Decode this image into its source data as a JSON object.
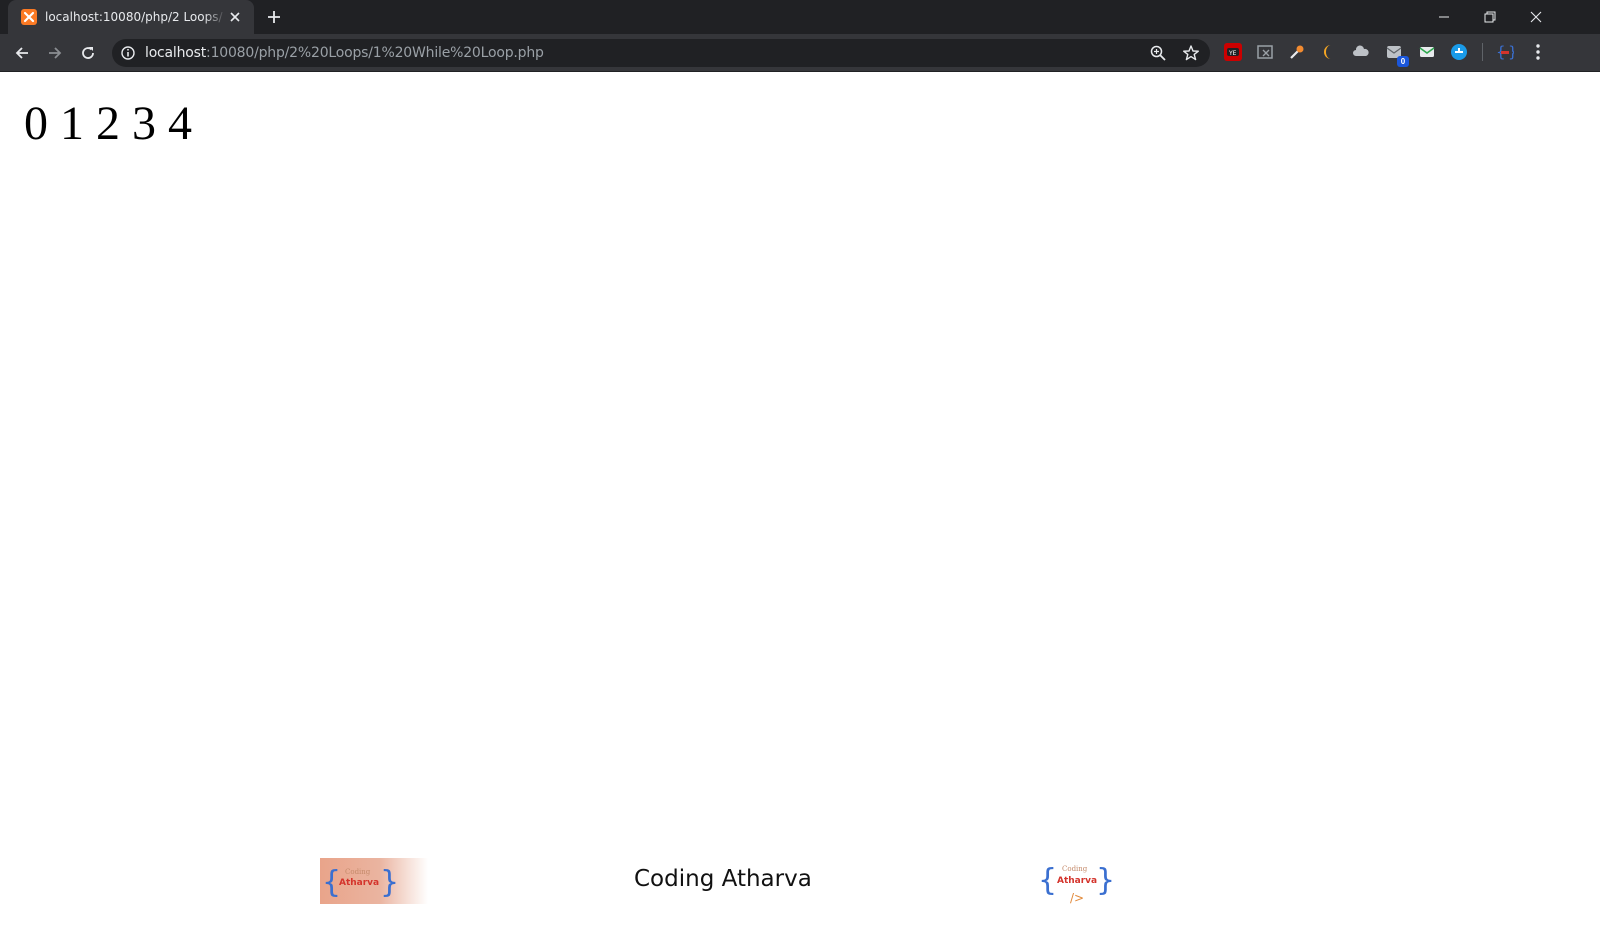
{
  "browser": {
    "tab": {
      "title": "localhost:10080/php/2 Loops/1 While Loop.php",
      "favicon": "xampp-icon"
    },
    "url": {
      "host": "localhost",
      "path": ":10080/php/2%20Loops/1%20While%20Loop.php"
    },
    "extensions": [
      "youtube-icon",
      "screen-capture-icon",
      "colorpick-icon",
      "moon-icon",
      "cloud-icon",
      "mail-checker-icon",
      "email-icon",
      "grammar-icon",
      "coding-atharva-ext-icon"
    ],
    "extension_badge": "0",
    "colors": {
      "tabbar": "#202124",
      "toolbar": "#35363a",
      "favicon": "#fb7a24"
    }
  },
  "page": {
    "output": "0 1 2 3 4"
  },
  "footer": {
    "brand_text": "Coding Atharva",
    "logo_small_text": "Coding",
    "logo_bold_text": "Atharva"
  }
}
